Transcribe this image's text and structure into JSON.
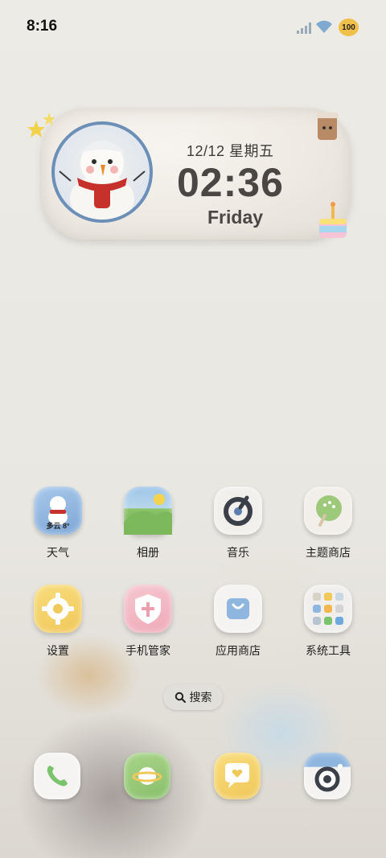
{
  "status_bar": {
    "time": "8:16",
    "battery": "100"
  },
  "widget": {
    "date": "12/12 星期五",
    "time": "02:36",
    "day": "Friday"
  },
  "apps": [
    {
      "label": "天气",
      "badge": "多云 8°"
    },
    {
      "label": "相册"
    },
    {
      "label": "音乐"
    },
    {
      "label": "主题商店"
    },
    {
      "label": "设置"
    },
    {
      "label": "手机管家"
    },
    {
      "label": "应用商店"
    },
    {
      "label": "系统工具"
    }
  ],
  "search": {
    "label": "搜索"
  },
  "dock": [
    "phone",
    "messages",
    "chat",
    "camera"
  ]
}
